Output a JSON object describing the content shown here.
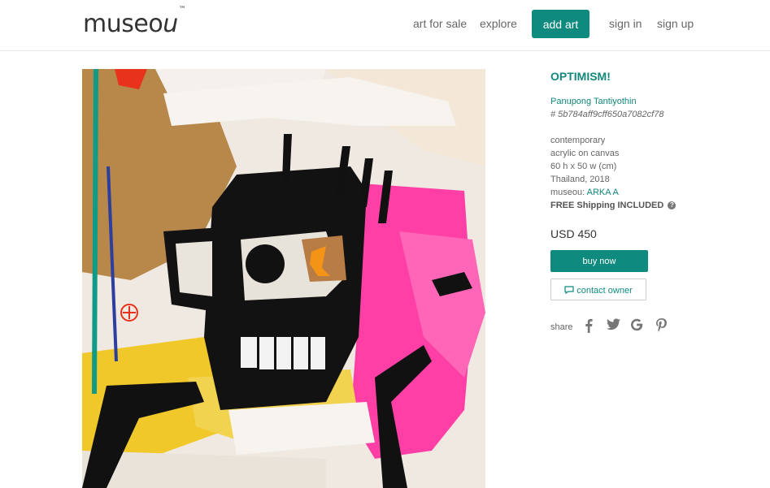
{
  "header": {
    "logo": "museo",
    "logo_u": "u",
    "logo_tm": "™",
    "nav": {
      "art_for_sale": "art for sale",
      "explore": "explore",
      "add_art": "add art",
      "sign_in": "sign in",
      "sign_up": "sign up"
    }
  },
  "artwork": {
    "title": "OPTIMISM!",
    "artist": "Panupong Tantiyothin",
    "hash": "# 5b784aff9cff650a7082cf78",
    "category": "contemporary",
    "medium": "acrylic on canvas",
    "dimensions": "60 h x 50 w (cm)",
    "origin": "Thailand, 2018",
    "museou_label": "museou:",
    "museou_value": "ARKA A",
    "shipping": "FREE Shipping INCLUDED",
    "price": "USD 450"
  },
  "actions": {
    "buy_now": "buy now",
    "contact_owner": "contact owner"
  },
  "share": {
    "label": "share",
    "icons": [
      "facebook-icon",
      "twitter-icon",
      "google-icon",
      "pinterest-icon"
    ]
  },
  "colors": {
    "accent": "#0f8a7e",
    "text": "#666666"
  }
}
